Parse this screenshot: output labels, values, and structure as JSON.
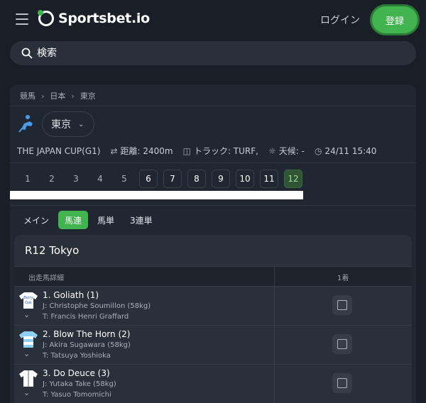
{
  "header": {
    "brand": "Sportsbet.io",
    "login_label": "ログイン",
    "register_label": "登録"
  },
  "search": {
    "placeholder": "検索"
  },
  "breadcrumb": [
    "競馬",
    "日本",
    "東京"
  ],
  "location": {
    "selected": "東京"
  },
  "race_info": {
    "name": "THE JAPAN CUP(G1)",
    "distance": "距離: 2400m",
    "track": "トラック: TURF,",
    "weather": "天候: -",
    "datetime": "24/11 15:40"
  },
  "race_tabs": [
    "1",
    "2",
    "3",
    "4",
    "5",
    "6",
    "7",
    "8",
    "9",
    "10",
    "11",
    "12"
  ],
  "active_race": "12",
  "bet_tabs": [
    "メイン",
    "馬連",
    "馬単",
    "3連単"
  ],
  "active_bet_tab": "馬連",
  "runners_card": {
    "title": "R12 Tokyo",
    "col_runner": "出走馬詳細",
    "col_first": "1着"
  },
  "runners": [
    {
      "name": "1. Goliath (1)",
      "jockey": "J: Christophe Soumillon (58kg)",
      "trainer": "T: Francis Henri Graffard",
      "silk_text": "Berry / Oak"
    },
    {
      "name": "2. Blow The Horn (2)",
      "jockey": "J: Akira Sugawara (58kg)",
      "trainer": "T: Tatsuya Yoshioka"
    },
    {
      "name": "3. Do Deuce (3)",
      "jockey": "J: Yutaka Take (58kg)",
      "trainer": "T: Yasuo Tomomichi"
    }
  ],
  "colors": {
    "accent": "#41b34f",
    "background": "#1a1f27",
    "card": "#212731"
  }
}
